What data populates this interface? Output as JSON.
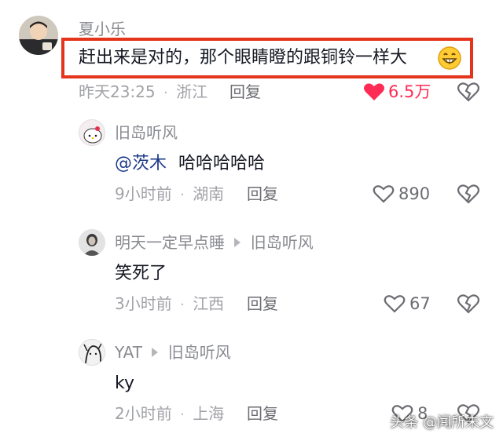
{
  "comments": [
    {
      "author": "夏小乐",
      "text": "赶出来是对的，那个眼睛瞪的跟铜铃一样大",
      "time": "昨天23:25",
      "location": "浙江",
      "reply_label": "回复",
      "likes": "6.5万",
      "liked": true
    },
    {
      "author": "旧岛听风",
      "mention": "@茨木",
      "text": "哈哈哈哈哈",
      "time": "9小时前",
      "location": "湖南",
      "reply_label": "回复",
      "likes": "890"
    },
    {
      "author": "明天一定早点睡",
      "reply_to": "旧岛听风",
      "text": "笑死了",
      "time": "3小时前",
      "location": "江西",
      "reply_label": "回复",
      "likes": "67"
    },
    {
      "author": "YAT",
      "reply_to": "旧岛听风",
      "text": "ky",
      "time": "2小时前",
      "location": "上海",
      "reply_label": "回复",
      "likes": "8"
    }
  ],
  "separator": "·",
  "watermark": "头条 @闻所未文",
  "colors": {
    "highlight_border": "#e5341c",
    "like_active": "#fe2c55",
    "mention": "#1e3a8a"
  },
  "icons": [
    "heart-icon",
    "heart-filled-icon",
    "dislike-broken-heart-icon",
    "grin-emoji-icon"
  ]
}
